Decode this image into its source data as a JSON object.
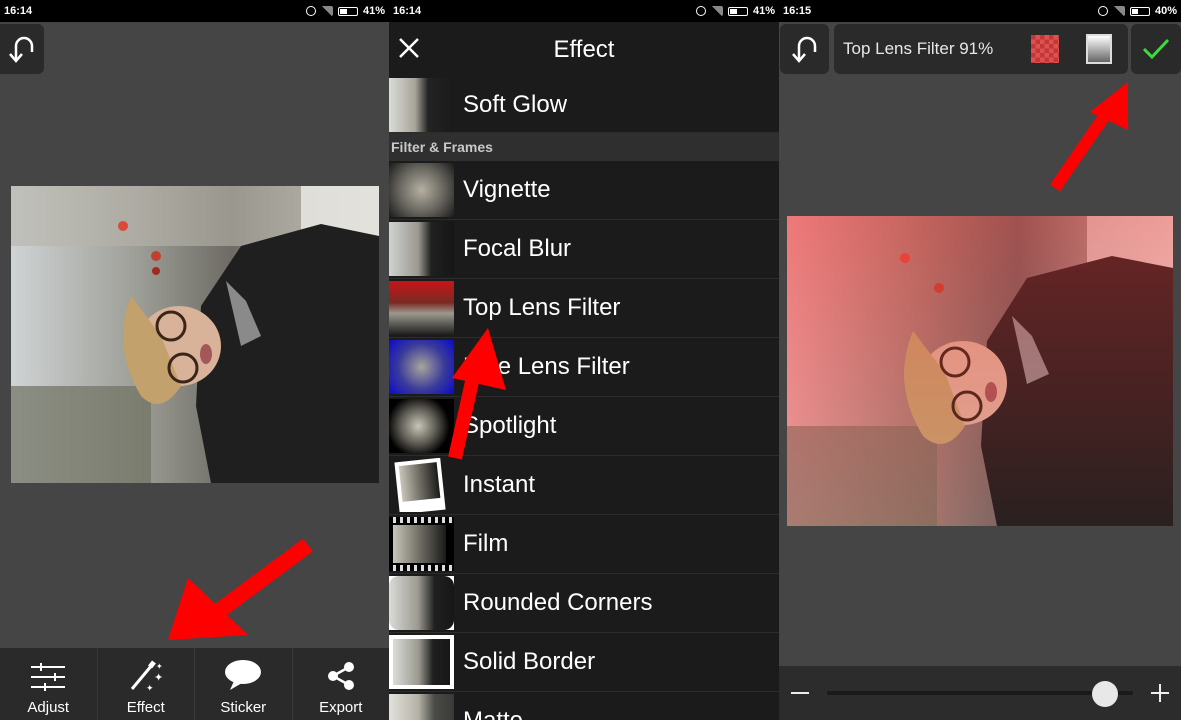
{
  "status_bars": [
    {
      "time": "16:14",
      "battery": "41%",
      "battery_level": 0.41
    },
    {
      "time": "16:14",
      "battery": "41%",
      "battery_level": 0.41
    },
    {
      "time": "16:15",
      "battery": "40%",
      "battery_level": 0.4
    }
  ],
  "editor": {
    "toolbar": [
      {
        "label": "Adjust",
        "icon": "sliders-icon"
      },
      {
        "label": "Effect",
        "icon": "magic-wand-icon"
      },
      {
        "label": "Sticker",
        "icon": "speech-bubble-icon"
      },
      {
        "label": "Export",
        "icon": "share-icon"
      }
    ]
  },
  "effect_panel": {
    "title": "Effect",
    "section": "Filter & Frames",
    "items": [
      {
        "label": "Soft Glow"
      },
      {
        "label": "Vignette"
      },
      {
        "label": "Focal Blur"
      },
      {
        "label": "Top Lens Filter"
      },
      {
        "label": "Blue Lens Filter"
      },
      {
        "label": "Spotlight"
      },
      {
        "label": "Instant"
      },
      {
        "label": "Film"
      },
      {
        "label": "Rounded Corners"
      },
      {
        "label": "Solid Border"
      },
      {
        "label": "Matte"
      }
    ]
  },
  "filter_editor": {
    "name": "Top Lens Filter 91%",
    "intensity": 0.91,
    "accent_color": "#3ddc3d"
  },
  "colors": {
    "arrow": "#ff0000",
    "panel_bg": "#454545",
    "bar_bg": "#2a2a2a"
  }
}
